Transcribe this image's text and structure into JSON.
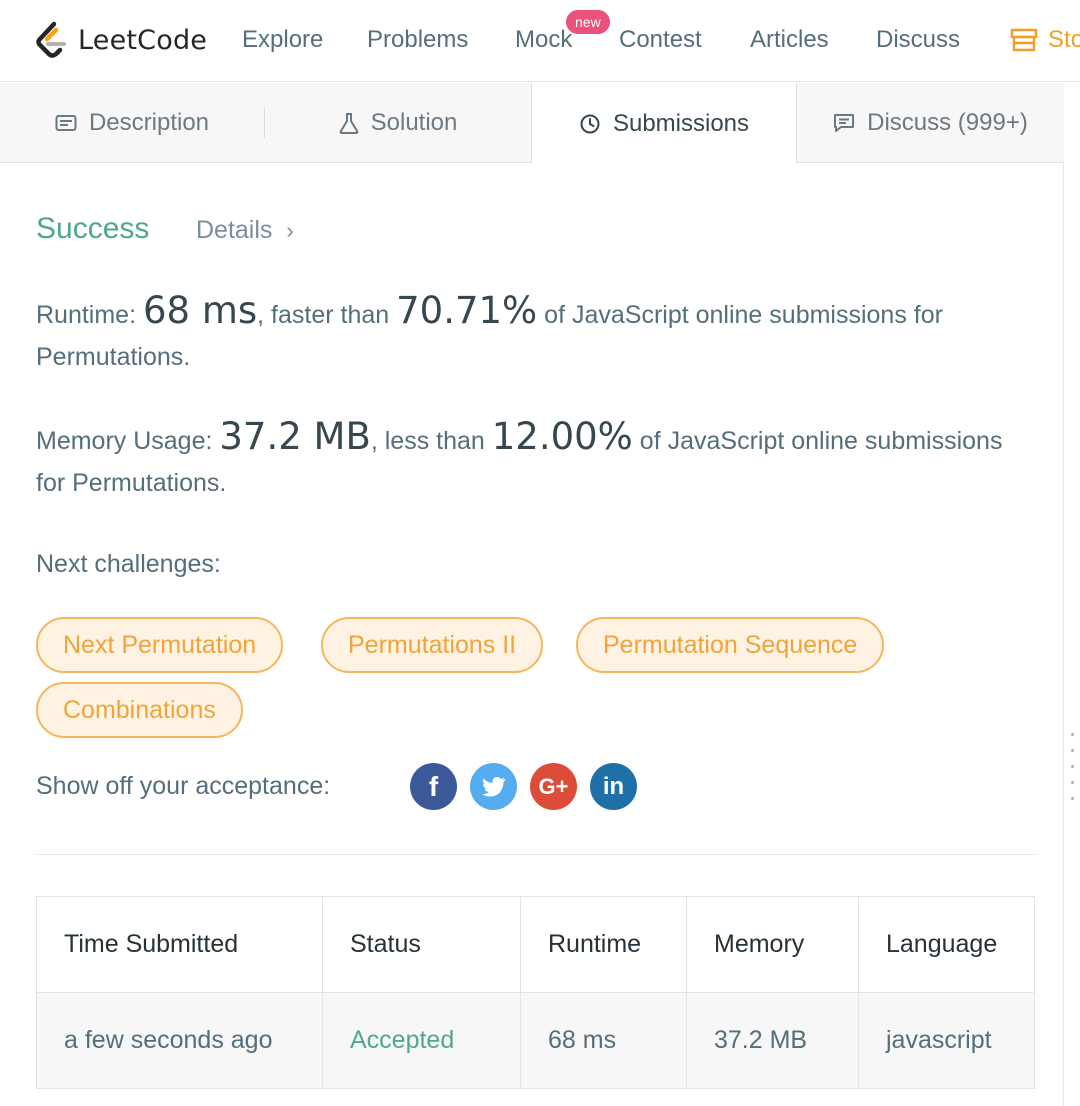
{
  "nav": {
    "brand": "LeetCode",
    "items": [
      "Explore",
      "Problems",
      "Mock",
      "Contest",
      "Articles",
      "Discuss"
    ],
    "new_badge": "new",
    "store": "Sto"
  },
  "tabs": {
    "description": "Description",
    "solution": "Solution",
    "submissions": "Submissions",
    "discuss": "Discuss (999+)"
  },
  "result": {
    "status": "Success",
    "details": "Details",
    "runtime_label": "Runtime: ",
    "runtime_value": "68 ms",
    "runtime_mid": ", faster than ",
    "runtime_pct": "70.71%",
    "runtime_tail": " of JavaScript online submissions for Permutations.",
    "memory_label": "Memory Usage: ",
    "memory_value": "37.2 MB",
    "memory_mid": ", less than ",
    "memory_pct": "12.00%",
    "memory_tail": " of JavaScript online submissions for Permutations."
  },
  "next_challenges": {
    "label": "Next challenges:",
    "items": [
      "Next Permutation",
      "Permutations II",
      "Permutation Sequence",
      "Combinations"
    ]
  },
  "share": {
    "label": "Show off your acceptance:",
    "icons": [
      "facebook-icon",
      "twitter-icon",
      "google-plus-icon",
      "linkedin-icon"
    ]
  },
  "submissions_table": {
    "headers": [
      "Time Submitted",
      "Status",
      "Runtime",
      "Memory",
      "Language"
    ],
    "rows": [
      [
        "a few seconds ago",
        "Accepted",
        "68 ms",
        "37.2 MB",
        "javascript"
      ]
    ]
  },
  "colors": {
    "success": "#4fa88d",
    "chip_border": "#f5b65c",
    "chip_text": "#f0a43a",
    "store": "#f0a028",
    "facebook": "#3b5998",
    "twitter": "#55acee",
    "google_plus": "#dd4b39",
    "linkedin": "#1f6fa8"
  }
}
